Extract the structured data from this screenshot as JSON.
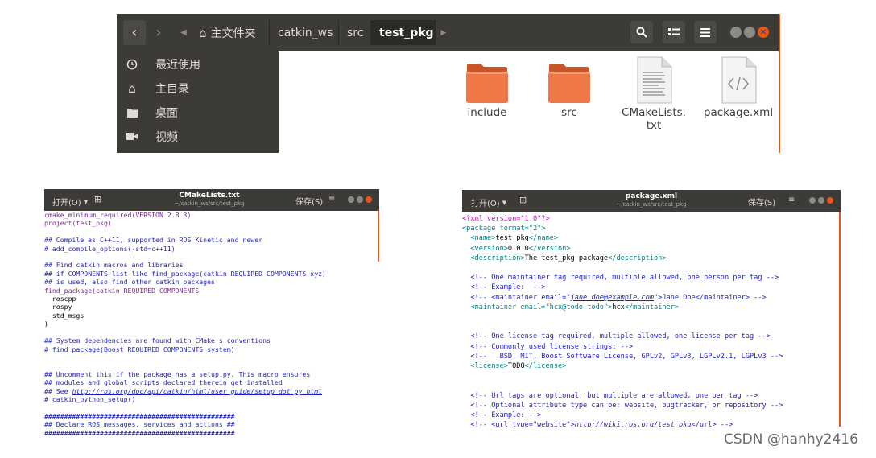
{
  "file_manager": {
    "breadcrumbs": [
      "主文件夹",
      "catkin_ws",
      "src",
      "test_pkg"
    ],
    "sidebar": [
      {
        "icon": "clock-icon",
        "label": "最近使用"
      },
      {
        "icon": "home-icon",
        "label": "主目录"
      },
      {
        "icon": "folder-icon",
        "label": "桌面"
      },
      {
        "icon": "video-icon",
        "label": "视频"
      }
    ],
    "files": [
      {
        "icon": "folder-icon",
        "name": "include"
      },
      {
        "icon": "folder-icon",
        "name": "src"
      },
      {
        "icon": "text-file-icon",
        "name_line1": "CMakeLists.",
        "name_line2": "txt"
      },
      {
        "icon": "xml-file-icon",
        "name": "package.xml"
      }
    ]
  },
  "editor_cmake": {
    "open_label": "打开(O)",
    "title": "CMakeLists.txt",
    "path": "~/catkin_ws/src/test_pkg",
    "save_label": "保存(S)",
    "lines": [
      {
        "cls": "c-fn",
        "text": "cmake_minimum_required(VERSION 2.8.3)"
      },
      {
        "cls": "c-fn",
        "text": "project(test_pkg)"
      },
      {
        "cls": "c-txt",
        "text": ""
      },
      {
        "cls": "c-cmt",
        "text": "## Compile as C++11, supported in ROS Kinetic and newer"
      },
      {
        "cls": "c-cmt",
        "text": "# add_compile_options(-std=c++11)"
      },
      {
        "cls": "c-txt",
        "text": ""
      },
      {
        "cls": "c-cmt",
        "text": "## Find catkin macros and libraries"
      },
      {
        "cls": "c-cmt",
        "text": "## if COMPONENTS list like find_package(catkin REQUIRED COMPONENTS xyz)"
      },
      {
        "cls": "c-cmt",
        "text": "## is used, also find other catkin packages"
      },
      {
        "cls": "c-fn",
        "text": "find_package(catkin REQUIRED COMPONENTS"
      },
      {
        "cls": "c-txt",
        "text": "  roscpp"
      },
      {
        "cls": "c-txt",
        "text": "  rospy"
      },
      {
        "cls": "c-txt",
        "text": "  std_msgs"
      },
      {
        "cls": "c-txt",
        "text": ")"
      },
      {
        "cls": "c-txt",
        "text": ""
      },
      {
        "cls": "c-cmt",
        "text": "## System dependencies are found with CMake's conventions"
      },
      {
        "cls": "c-cmt",
        "text": "# find_package(Boost REQUIRED COMPONENTS system)"
      },
      {
        "cls": "c-txt",
        "text": ""
      },
      {
        "cls": "c-txt",
        "text": ""
      },
      {
        "cls": "c-cmt",
        "text": "## Uncomment this if the package has a setup.py. This macro ensures"
      },
      {
        "cls": "c-cmt",
        "text": "## modules and global scripts declared therein get installed"
      },
      {
        "cls": "c-cmt",
        "text": "## See ",
        "link": "http://ros.org/doc/api/catkin/html/user_guide/setup_dot_py.html"
      },
      {
        "cls": "c-cmt",
        "text": "# catkin_python_setup()"
      },
      {
        "cls": "c-txt",
        "text": ""
      },
      {
        "cls": "c-hash",
        "text": "################################################"
      },
      {
        "cls": "c-cmt",
        "text": "## Declare ROS messages, services and actions ##"
      },
      {
        "cls": "c-hash",
        "text": "################################################"
      }
    ]
  },
  "editor_xml": {
    "open_label": "打开(O)",
    "title": "package.xml",
    "path": "~/catkin_ws/src/test_pkg",
    "save_label": "保存(S)",
    "lines": [
      {
        "cls": "c-str",
        "text": "<?xml version=\"1.0\"?>"
      },
      {
        "cls": "c-tag",
        "text": "<package format=\"2\">"
      },
      {
        "cls": "c-tag",
        "text": "  <name>",
        "tail": "test_pkg",
        "close": "</name>"
      },
      {
        "cls": "c-tag",
        "text": "  <version>",
        "tail": "0.0.0",
        "close": "</version>"
      },
      {
        "cls": "c-tag",
        "text": "  <description>",
        "tail": "The test_pkg package",
        "close": "</description>"
      },
      {
        "cls": "c-txt",
        "text": ""
      },
      {
        "cls": "c-xmlcmt",
        "text": "  <!-- One maintainer tag required, multiple allowed, one person per tag -->"
      },
      {
        "cls": "c-xmlcmt",
        "text": "  <!-- Example:  -->"
      },
      {
        "cls": "c-xmlcmt",
        "text": "  <!-- <maintainer email=\"",
        "link": "jane.doe@example.com",
        "after": "\">Jane Doe</maintainer> -->"
      },
      {
        "cls": "c-tag",
        "text": "  <maintainer email=\"hcx@todo.todo\">",
        "tail": "hcx",
        "close": "</maintainer>"
      },
      {
        "cls": "c-txt",
        "text": ""
      },
      {
        "cls": "c-txt",
        "text": ""
      },
      {
        "cls": "c-xmlcmt",
        "text": "  <!-- One license tag required, multiple allowed, one license per tag -->"
      },
      {
        "cls": "c-xmlcmt",
        "text": "  <!-- Commonly used license strings: -->"
      },
      {
        "cls": "c-xmlcmt",
        "text": "  <!--   BSD, MIT, Boost Software License, GPLv2, GPLv3, LGPLv2.1, LGPLv3 -->"
      },
      {
        "cls": "c-tag",
        "text": "  <license>",
        "tail": "TODO",
        "close": "</license>"
      },
      {
        "cls": "c-txt",
        "text": ""
      },
      {
        "cls": "c-txt",
        "text": ""
      },
      {
        "cls": "c-xmlcmt",
        "text": "  <!-- Url tags are optional, but multiple are allowed, one per tag -->"
      },
      {
        "cls": "c-xmlcmt",
        "text": "  <!-- Optional attribute type can be: website, bugtracker, or repository -->"
      },
      {
        "cls": "c-xmlcmt",
        "text": "  <!-- Example: -->"
      },
      {
        "cls": "c-xmlcmt",
        "text": "  <!-- <url type=\"website\">",
        "link": "http://wiki.ros.org/test_pkg",
        "after": "</url> -->"
      }
    ]
  },
  "watermark": "CSDN @hanhy2416",
  "colors": {
    "ubuntu_dark": "#3c3b37",
    "accent_orange": "#e8561c",
    "folder_orange": "#f07746"
  }
}
